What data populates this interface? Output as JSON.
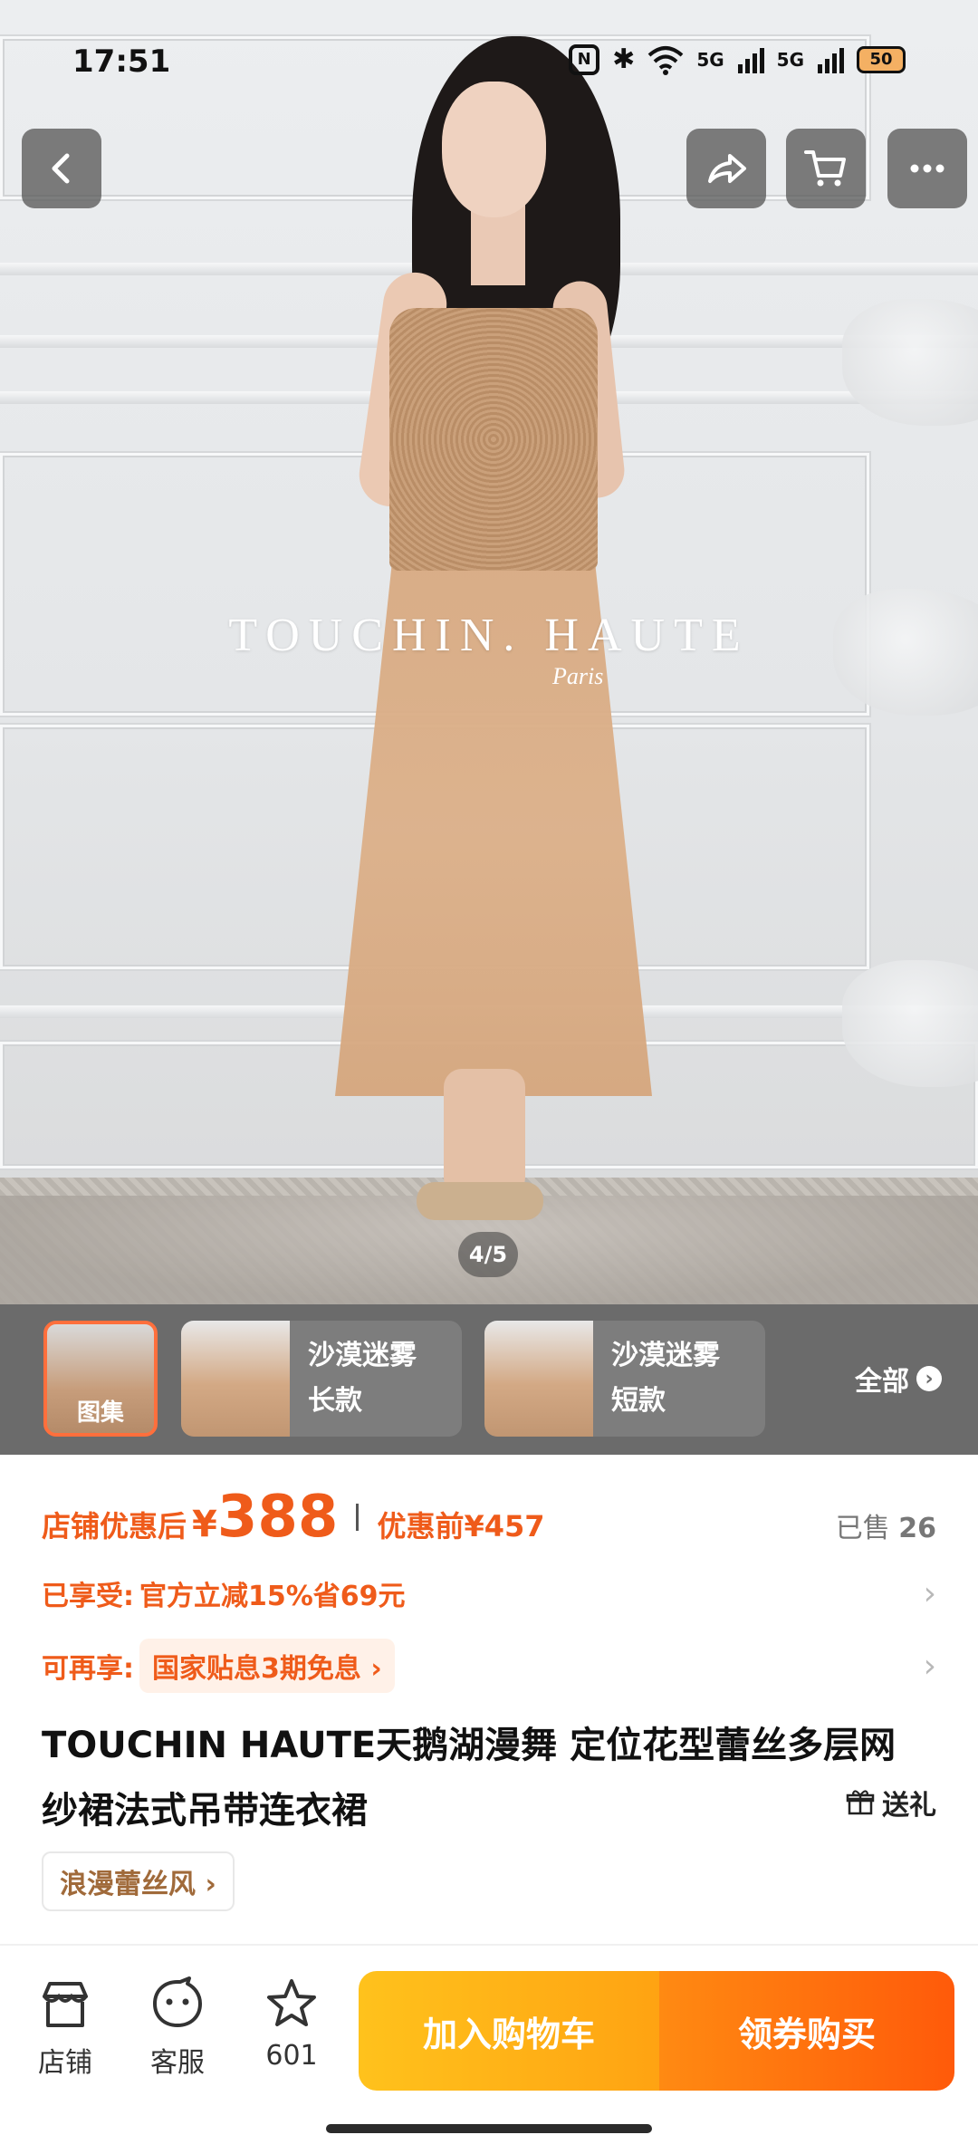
{
  "status_bar": {
    "time": "17:51",
    "nfc_label": "N",
    "signal1": "5G",
    "signal2": "5G",
    "battery": "50"
  },
  "top_bar": {
    "back_icon": "chevron-left-icon",
    "share_icon": "share-icon",
    "cart_icon": "cart-icon",
    "more_icon": "more-icon"
  },
  "hero": {
    "brand_text": "TOUCHIN. HAUTE",
    "brand_sub": "Paris",
    "counter": "4/5"
  },
  "variants": {
    "gallery_label": "图集",
    "items": [
      {
        "line1": "沙漠迷雾",
        "line2": "长款"
      },
      {
        "line1": "沙漠迷雾",
        "line2": "短款"
      }
    ],
    "all_label": "全部"
  },
  "price": {
    "label": "店铺优惠后",
    "currency": "¥",
    "amount": "388",
    "before_label": "优惠前¥457",
    "sold_label": "已售",
    "sold_count": "26"
  },
  "promo": {
    "enjoyed_key": "已享受:",
    "enjoyed_value": "官方立减15%省69元",
    "more_key": "可再享:",
    "more_value": "国家贴息3期免息 ›"
  },
  "product": {
    "title": "TOUCHIN HAUTE天鹅湖漫舞 定位花型蕾丝多层网纱裙法式吊带连衣裙",
    "gift_label": "送礼",
    "style_tag": "浪漫蕾丝风 ›"
  },
  "bottom_bar": {
    "shop_label": "店铺",
    "service_label": "客服",
    "favorite_count": "601",
    "add_to_cart": "加入购物车",
    "buy_with_coupon": "领券购买"
  },
  "colors": {
    "accent": "#ef5b1a",
    "cta_cart": "#ffb316",
    "cta_buy": "#ff6a0e",
    "strip_bg": "#6b6b6b"
  }
}
